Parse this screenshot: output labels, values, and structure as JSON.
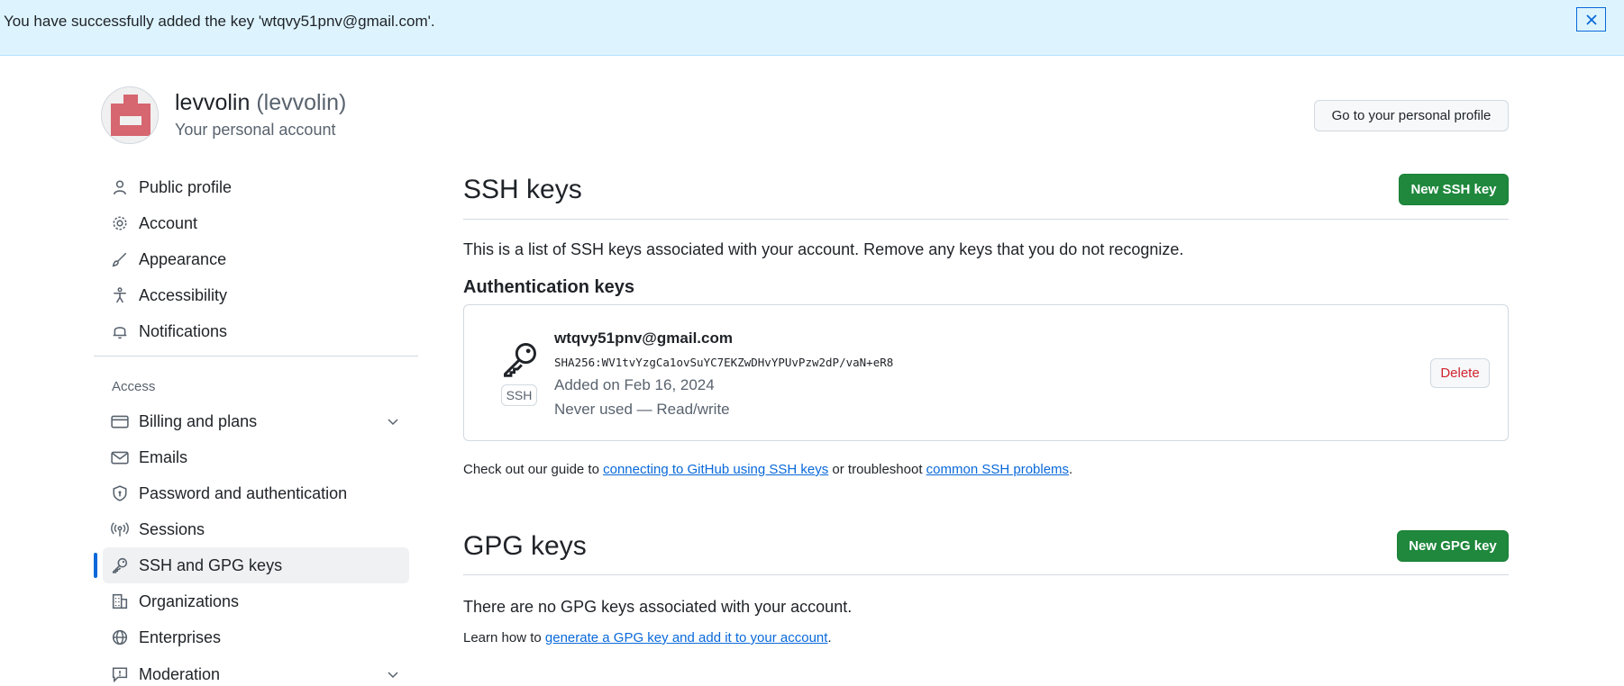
{
  "flash": {
    "message": "You have successfully added the key 'wtqvy51pnv@gmail.com'.",
    "close_icon": "x-icon"
  },
  "header": {
    "display_name": "levvolin",
    "login": "(levvolin)",
    "subtitle": "Your personal account",
    "profile_button": "Go to your personal profile"
  },
  "sidebar": {
    "items": [
      {
        "label": "Public profile",
        "icon": "person-icon"
      },
      {
        "label": "Account",
        "icon": "gear-icon"
      },
      {
        "label": "Appearance",
        "icon": "paintbrush-icon"
      },
      {
        "label": "Accessibility",
        "icon": "accessibility-icon"
      },
      {
        "label": "Notifications",
        "icon": "bell-icon"
      }
    ],
    "access_heading": "Access",
    "access_items": [
      {
        "label": "Billing and plans",
        "icon": "credit-card-icon",
        "expandable": true
      },
      {
        "label": "Emails",
        "icon": "mail-icon"
      },
      {
        "label": "Password and authentication",
        "icon": "shield-lock-icon"
      },
      {
        "label": "Sessions",
        "icon": "broadcast-icon"
      },
      {
        "label": "SSH and GPG keys",
        "icon": "key-icon",
        "active": true
      },
      {
        "label": "Organizations",
        "icon": "organization-icon"
      },
      {
        "label": "Enterprises",
        "icon": "globe-icon"
      },
      {
        "label": "Moderation",
        "icon": "report-icon",
        "expandable": true
      }
    ]
  },
  "ssh": {
    "title": "SSH keys",
    "new_button": "New SSH key",
    "description": "This is a list of SSH keys associated with your account. Remove any keys that you do not recognize.",
    "auth_heading": "Authentication keys",
    "key": {
      "badge": "SSH",
      "title": "wtqvy51pnv@gmail.com",
      "fingerprint": "SHA256:WV1tvYzgCa1ovSuYC7EKZwDHvYPUvPzw2dP/vaN+eR8",
      "added": "Added on Feb 16, 2024",
      "usage": "Never used — Read/write",
      "delete_label": "Delete"
    },
    "guide_prefix": "Check out our guide to ",
    "guide_link": "connecting to GitHub using SSH keys",
    "guide_middle": " or troubleshoot ",
    "guide_link2": "common SSH problems",
    "guide_suffix": "."
  },
  "gpg": {
    "title": "GPG keys",
    "new_button": "New GPG key",
    "empty": "There are no GPG keys associated with your account.",
    "learn_prefix": "Learn how to ",
    "learn_link": "generate a GPG key and add it to your account",
    "learn_suffix": "."
  },
  "colors": {
    "accent": "#0969da",
    "primary_button": "#1f883d",
    "danger": "#d1242f",
    "flash_bg": "#ddf4ff"
  }
}
